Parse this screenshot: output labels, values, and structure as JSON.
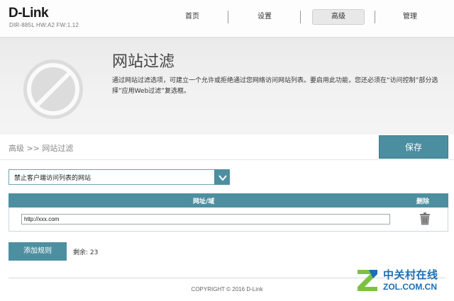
{
  "header": {
    "logo": "D-Link",
    "model": "DIR-885L HW:A2 FW:1.12",
    "nav": [
      "首页",
      "设置",
      "高级",
      "管理"
    ],
    "active_nav": "高级"
  },
  "banner": {
    "title": "网站过滤",
    "description": "通过网站过滤选项，可建立一个允许或拒绝通过您网络访问网站列表。要启用此功能，您还必须在“访问控制”部分选择”应用Web过滤”复选框。",
    "icon": "filter-badge-icon"
  },
  "breadcrumb": "高级 >> 网站过滤",
  "save_label": "保存",
  "filter_mode": {
    "selected": "禁止客户端访问列表的网站"
  },
  "table": {
    "headers": [
      "网址/域",
      "删除"
    ],
    "rows": [
      {
        "url": "http://xxx.com"
      }
    ]
  },
  "add_rule_label": "添加规则",
  "remaining": "剩余: 23",
  "footer": "COPYRIGHT © 2016 D-Link",
  "watermark": {
    "title": "中关村在线",
    "site": "ZOL.COM.CN"
  },
  "colors": {
    "accent": "#4d8fa0",
    "watermark": "#1a6fb5"
  }
}
